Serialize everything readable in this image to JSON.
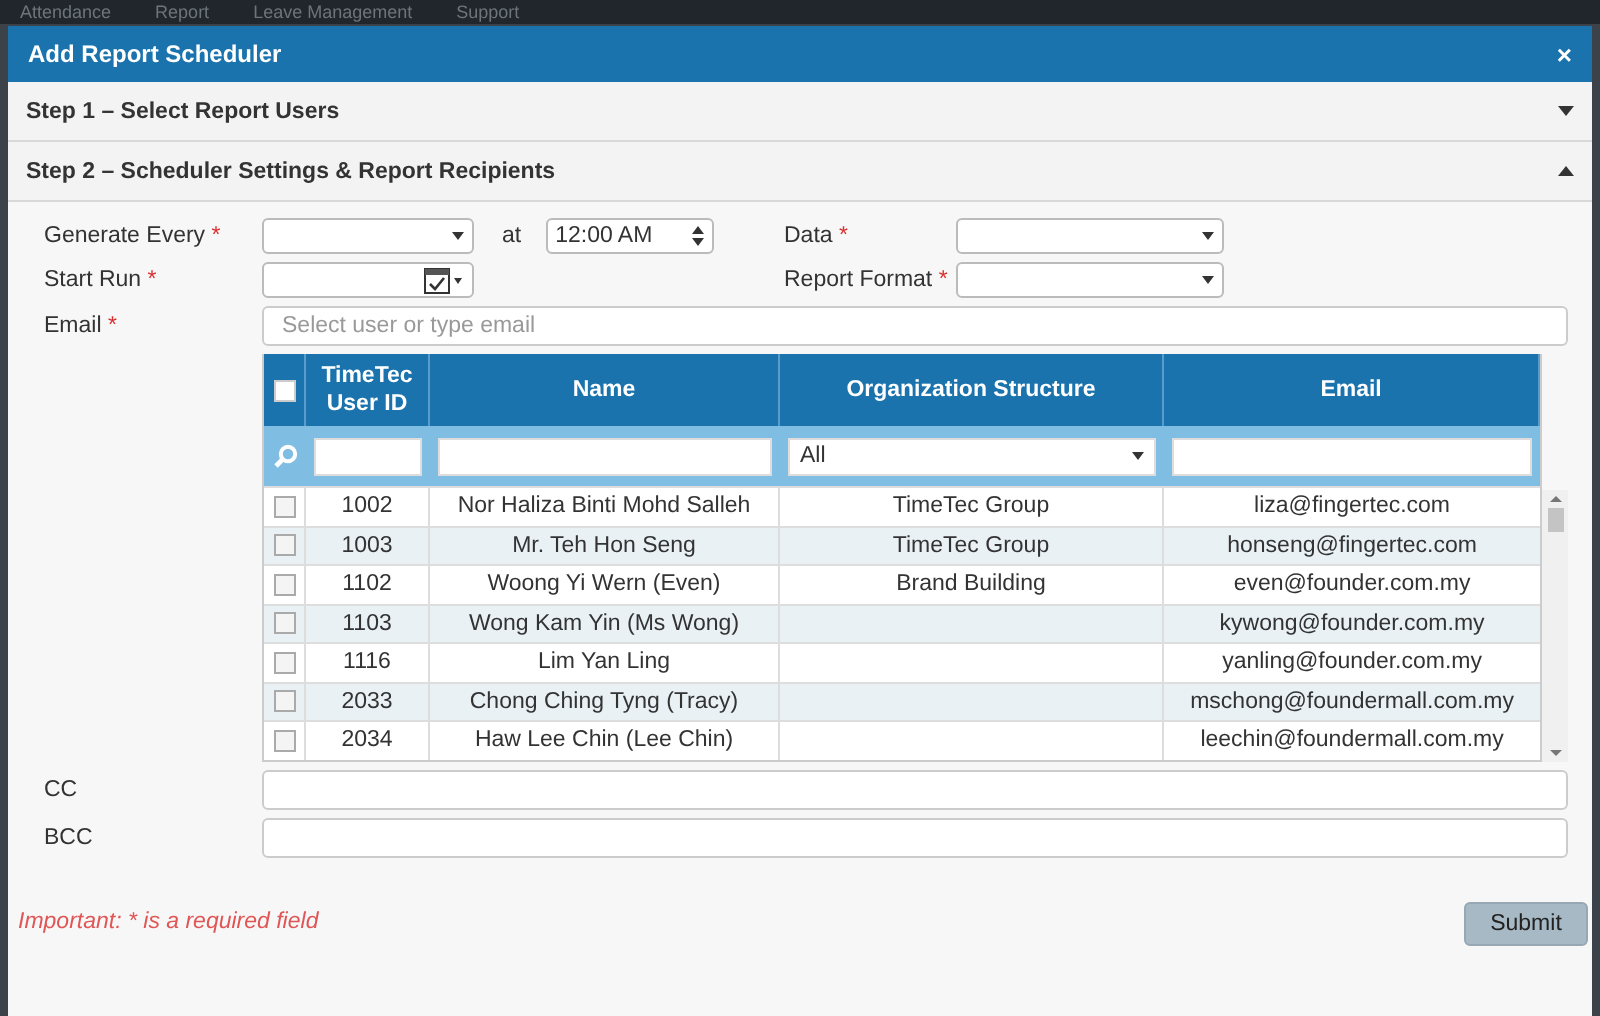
{
  "background_nav": [
    "Attendance",
    "Report",
    "Leave Management",
    "Support"
  ],
  "dialog": {
    "title": "Add Report Scheduler",
    "close": "×"
  },
  "steps": [
    {
      "label": "Step 1 – Select Report Users",
      "expanded": false
    },
    {
      "label": "Step 2 – Scheduler Settings & Report Recipients",
      "expanded": true
    }
  ],
  "form": {
    "generate_every": {
      "label": "Generate Every",
      "mark": "*"
    },
    "at_label": "at",
    "time": {
      "value": "12:00 AM"
    },
    "start_run": {
      "label": "Start Run",
      "mark": "*"
    },
    "data": {
      "label": "Data",
      "mark": "*"
    },
    "report_format": {
      "label": "Report Format",
      "mark": "*"
    },
    "email": {
      "label": "Email",
      "mark": "*",
      "placeholder": "Select user or type email"
    }
  },
  "table": {
    "select_all_checked": false,
    "columns": [
      "TimeTec User ID",
      "Name",
      "Organization Structure",
      "Email"
    ],
    "filters": {
      "organization": "All"
    },
    "rows": [
      {
        "checked": false,
        "id": "1002",
        "name": "Nor Haliza Binti Mohd Salleh",
        "organization": "TimeTec Group",
        "email": "liza@fingertec.com"
      },
      {
        "checked": false,
        "id": "1003",
        "name": "Mr. Teh Hon Seng",
        "organization": "TimeTec Group",
        "email": "honseng@fingertec.com"
      },
      {
        "checked": false,
        "id": "1102",
        "name": "Woong Yi Wern (Even)",
        "organization": "Brand Building",
        "email": "even@founder.com.my"
      },
      {
        "checked": false,
        "id": "1103",
        "name": "Wong Kam Yin (Ms Wong)",
        "email": "kywong@founder.com.my"
      },
      {
        "checked": false,
        "id": "1116",
        "name": "Lim Yan Ling",
        "email": "yanling@founder.com.my"
      },
      {
        "checked": false,
        "id": "2033",
        "name": "Chong Ching Tyng (Tracy)",
        "email": "mschong@foundermall.com.my"
      },
      {
        "checked": false,
        "id": "2034",
        "name": "Haw Lee Chin (Lee Chin)",
        "email": "leechin@foundermall.com.my"
      }
    ]
  },
  "cc": {
    "label": "CC"
  },
  "bcc": {
    "label": "BCC"
  },
  "note": "Important: * is a required field",
  "submit": "Submit"
}
